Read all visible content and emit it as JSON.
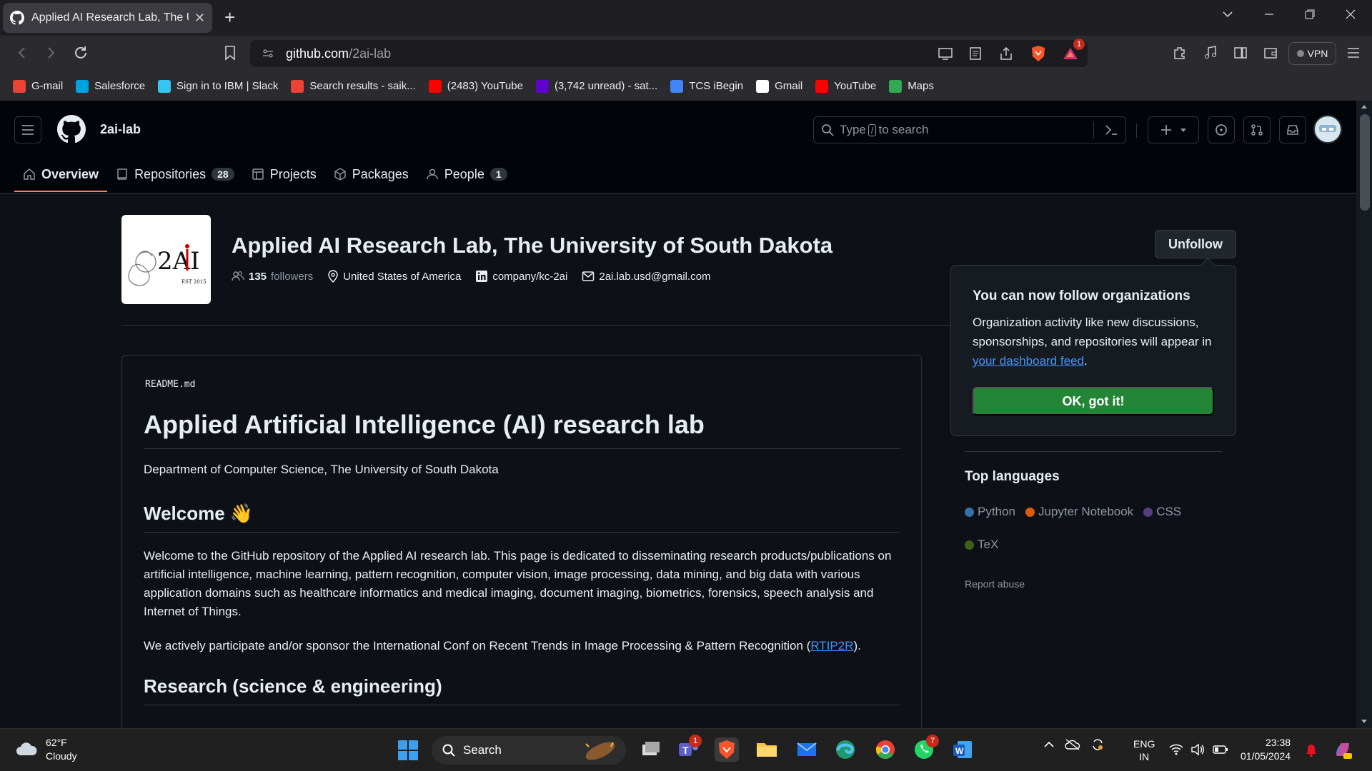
{
  "browser": {
    "tab_title": "Applied AI Research Lab, The University of South Dakota",
    "tab_close": "✕",
    "new_tab": "+",
    "url_host": "github.com",
    "url_path": "/2ai-lab",
    "vpn_label": "VPN",
    "alert_count": "1",
    "bookmarks": [
      {
        "label": "G-mail",
        "color": "#ea4335"
      },
      {
        "label": "Salesforce",
        "color": "#00a1e0"
      },
      {
        "label": "Sign in to IBM | Slack",
        "color": "#36c5f0"
      },
      {
        "label": "Search results - saik...",
        "color": "#ea4335"
      },
      {
        "label": "(2483) YouTube",
        "color": "#ff0000"
      },
      {
        "label": "(3,742 unread) - sat...",
        "color": "#6001d2"
      },
      {
        "label": "TCS iBegin",
        "color": "#4285f4"
      },
      {
        "label": "Gmail",
        "color": "#ffffff"
      },
      {
        "label": "YouTube",
        "color": "#ff0000"
      },
      {
        "label": "Maps",
        "color": "#34a853"
      }
    ]
  },
  "github": {
    "org_slug": "2ai-lab",
    "search_prefix": "Type",
    "search_slash": "/",
    "search_suffix": "to search",
    "tabs": [
      {
        "label": "Overview",
        "counter": ""
      },
      {
        "label": "Repositories",
        "counter": "28"
      },
      {
        "label": "Projects",
        "counter": ""
      },
      {
        "label": "Packages",
        "counter": ""
      },
      {
        "label": "People",
        "counter": "1"
      }
    ],
    "org_title": "Applied AI Research Lab, The University of South Dakota",
    "followers_count": "135",
    "followers_label": "followers",
    "location": "United States of America",
    "linkedin": "company/kc-2ai",
    "email": "2ai.lab.usd@gmail.com",
    "unfollow_label": "Unfollow",
    "logo_text": "2AI",
    "logo_sub": "EST 2015"
  },
  "popover": {
    "title": "You can now follow organizations",
    "body_before": "Organization activity like new discussions, sponsorships, and repositories will appear in ",
    "link": "your dashboard feed",
    "body_after": ".",
    "ok_label": "OK, got it!"
  },
  "readme": {
    "filename": "README.md",
    "h1": "Applied Artificial Intelligence (AI) research lab",
    "dept": "Department of Computer Science, The University of South Dakota",
    "h2_welcome": "Welcome 👋",
    "para1": "Welcome to the GitHub repository of the Applied AI research lab. This page is dedicated to disseminating research products/publications on artificial intelligence, machine learning, pattern recognition, computer vision, image processing, data mining, and big data with various application domains such as healthcare informatics and medical imaging, document imaging, biometrics, forensics, speech analysis and Internet of Things.",
    "para2_before": "We actively participate and/or sponsor the International Conf on Recent Trends in Image Processing & Pattern Recognition (",
    "para2_link": "RTIP2R",
    "para2_after": ").",
    "h2_research": "Research (science & engineering)"
  },
  "sidebar": {
    "top_languages": "Top languages",
    "languages": [
      {
        "name": "Python",
        "color": "#3572A5"
      },
      {
        "name": "Jupyter Notebook",
        "color": "#DA5B0B"
      },
      {
        "name": "CSS",
        "color": "#563d7c"
      },
      {
        "name": "TeX",
        "color": "#3D6117"
      }
    ],
    "report_abuse": "Report abuse"
  },
  "taskbar": {
    "temp": "62°F",
    "weather": "Cloudy",
    "search_label": "Search",
    "teams_badge": "1",
    "whatsapp_badge": "7",
    "lang_top": "ENG",
    "lang_bottom": "IN",
    "time": "23:38",
    "date": "01/05/2024"
  }
}
